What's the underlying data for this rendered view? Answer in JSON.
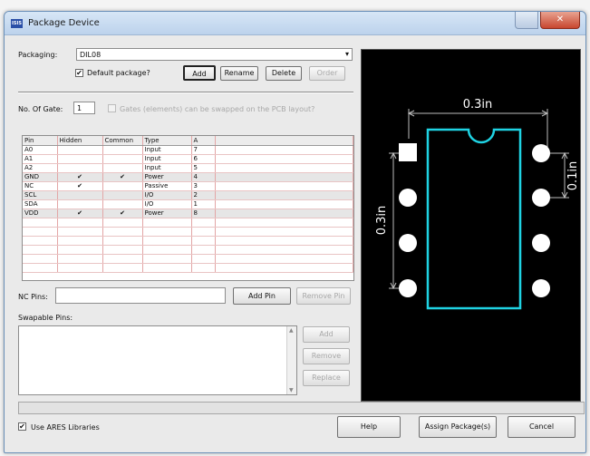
{
  "window": {
    "title": "Package Device",
    "app_icon_text": "ISIS"
  },
  "packaging": {
    "label": "Packaging:",
    "value": "DIL08",
    "default_label": "Default package?",
    "default_checked": true,
    "add_label": "Add",
    "rename_label": "Rename",
    "delete_label": "Delete",
    "order_label": "Order"
  },
  "gates": {
    "label": "No. Of Gate:",
    "value": "1",
    "swap_label": "Gates (elements) can be swapped on the PCB layout?",
    "swap_checked": false
  },
  "pin_table": {
    "columns": [
      "Pin",
      "Hidden",
      "Common",
      "Type",
      "A"
    ],
    "rows": [
      {
        "pin": "A0",
        "hidden": "",
        "common": "",
        "type": "Input",
        "a": "7",
        "highlighted": false
      },
      {
        "pin": "A1",
        "hidden": "",
        "common": "",
        "type": "Input",
        "a": "6",
        "highlighted": false
      },
      {
        "pin": "A2",
        "hidden": "",
        "common": "",
        "type": "Input",
        "a": "5",
        "highlighted": false
      },
      {
        "pin": "GND",
        "hidden": "✔",
        "common": "✔",
        "type": "Power",
        "a": "4",
        "highlighted": true
      },
      {
        "pin": "NC",
        "hidden": "✔",
        "common": "",
        "type": "Passive",
        "a": "3",
        "highlighted": false
      },
      {
        "pin": "SCL",
        "hidden": "",
        "common": "",
        "type": "I/O",
        "a": "2",
        "highlighted": true
      },
      {
        "pin": "SDA",
        "hidden": "",
        "common": "",
        "type": "I/O",
        "a": "1",
        "highlighted": false
      },
      {
        "pin": "VDD",
        "hidden": "✔",
        "common": "✔",
        "type": "Power",
        "a": "8",
        "highlighted": true
      }
    ]
  },
  "nc_pins": {
    "label": "NC Pins:",
    "value": "",
    "add_label": "Add Pin",
    "remove_label": "Remove Pin"
  },
  "swapable": {
    "label": "Swapable Pins:",
    "add_label": "Add",
    "remove_label": "Remove",
    "replace_label": "Replace"
  },
  "preview": {
    "dim_width": "0.3in",
    "dim_height": "0.3in",
    "dim_pitch": "0.1in",
    "outline_color": "#1fd3e3",
    "pad_color": "#ffffff",
    "background": "#000000"
  },
  "footer": {
    "use_ares_label": "Use ARES Libraries",
    "use_ares_checked": true,
    "help_label": "Help",
    "assign_label": "Assign Package(s)",
    "cancel_label": "Cancel"
  }
}
